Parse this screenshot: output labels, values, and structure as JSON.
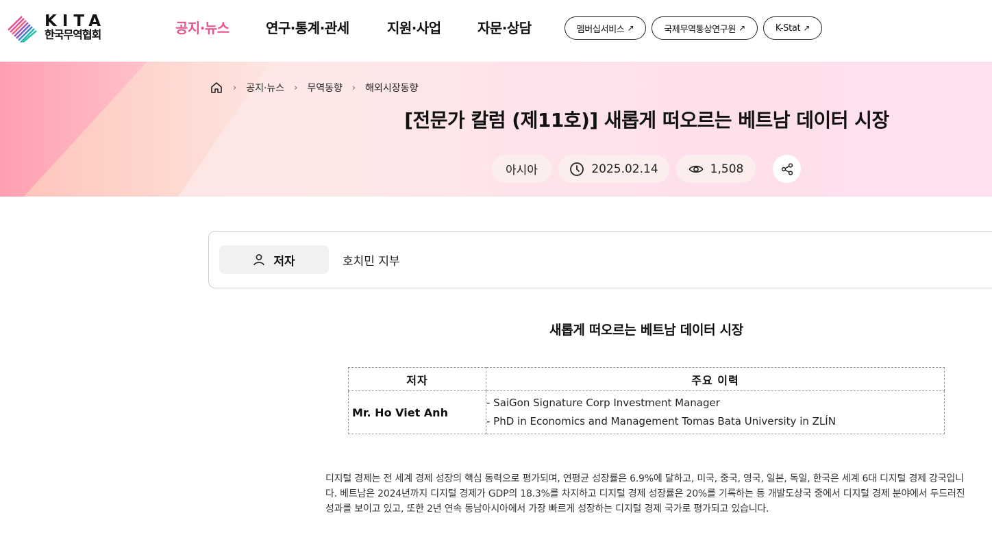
{
  "header": {
    "logo": {
      "en": "KITA",
      "ko": "한국무역협회"
    },
    "nav": [
      {
        "label": "공지·뉴스",
        "active": true
      },
      {
        "label": "연구·통계·관세",
        "active": false
      },
      {
        "label": "지원·사업",
        "active": false
      },
      {
        "label": "자문·상담",
        "active": false
      }
    ],
    "external_links": [
      {
        "label": "멤버십서비스",
        "icon": "external-arrow-icon"
      },
      {
        "label": "국제무역통상연구원",
        "icon": "external-arrow-icon"
      },
      {
        "label": "K-Stat",
        "icon": "external-arrow-icon"
      }
    ],
    "accent_color": "#e8538f"
  },
  "hero": {
    "breadcrumb": [
      "공지·뉴스",
      "무역동향",
      "해외시장동향"
    ],
    "title": "[전문가 칼럼 (제11호)] 새롭게 떠오르는 베트남 데이터 시장",
    "region": "아시아",
    "date": "2025.02.14",
    "views": "1,508"
  },
  "author": {
    "tag": "저자",
    "name": "호치민 지부"
  },
  "article": {
    "title": "새롭게 떠오르는 베트남 데이터 시장",
    "table": {
      "headers": [
        "저자",
        "주요 이력"
      ],
      "rows": [
        {
          "name": "Mr. Ho Viet Anh",
          "career": [
            "- SaiGon Signature Corp Investment Manager",
            "- PhD in Economics and Management Tomas Bata University in ZLÍN"
          ]
        }
      ]
    },
    "paragraph": " 디지털 경제는 전 세계 경제 성장의 핵심 동력으로 평가되며, 연평균 성장률은 6.9%에 달하고, 미국, 중국, 영국, 일본, 독일, 한국은 세계 6대 디지털 경제 강국입니다. 베트남은 2024년까지 디지털 경제가 GDP의 18.3%를 차지하고 디지털 경제 성장률은 20%를 기록하는 등 개발도상국 중에서 디지털 경제 분야에서 두드러진 성과를 보이고 있고, 또한 2년 연속 동남아시아에서 가장 빠르게 성장하는 디지털 경제 국가로 평가되고 있습니다."
  }
}
